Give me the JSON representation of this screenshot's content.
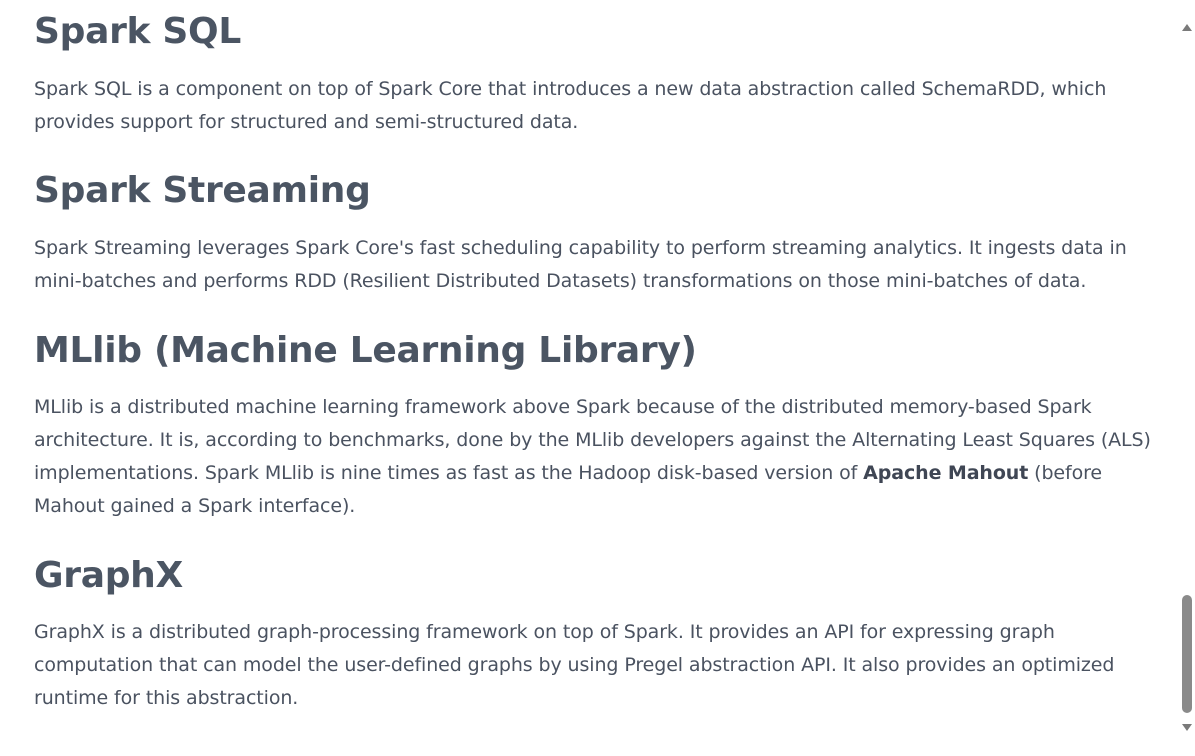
{
  "sections": {
    "spark_sql": {
      "heading": "Spark SQL",
      "text": "Spark SQL is a component on top of Spark Core that introduces a new data abstraction called SchemaRDD, which provides support for structured and semi-structured data."
    },
    "spark_streaming": {
      "heading": "Spark Streaming",
      "text": "Spark Streaming leverages Spark Core's fast scheduling capability to perform streaming analytics. It ingests data in mini-batches and performs RDD (Resilient Distributed Datasets) transformations on those mini-batches of data."
    },
    "mllib": {
      "heading": "MLlib (Machine Learning Library)",
      "text_before": "MLlib is a distributed machine learning framework above Spark because of the distributed memory-based Spark architecture. It is, according to benchmarks, done by the MLlib developers against the Alternating Least Squares (ALS) implementations. Spark MLlib is nine times as fast as the Hadoop disk-based version of ",
      "text_bold": "Apache Mahout",
      "text_after": " (before Mahout gained a Spark interface)."
    },
    "graphx": {
      "heading": "GraphX",
      "text": "GraphX is a distributed graph-processing framework on top of Spark. It provides an API for expressing graph computation that can model the user-defined graphs by using Pregel abstraction API. It also provides an optimized runtime for this abstraction."
    }
  },
  "scrollbar": {
    "up_icon": "triangle-up-icon",
    "down_icon": "triangle-down-icon",
    "thumb_color": "#8a8a8a"
  },
  "colors": {
    "heading": "#4b5563",
    "body_text": "#4a5260",
    "background": "#ffffff"
  }
}
